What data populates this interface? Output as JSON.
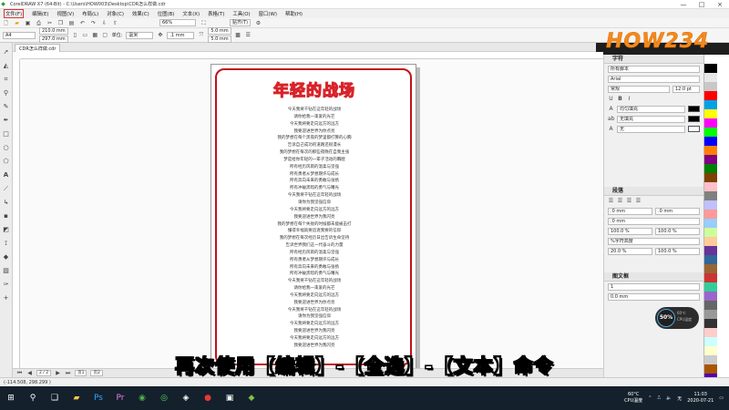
{
  "window": {
    "title": "CorelDRAW X7 (64-Bit) - C:\\Users\\HOW003\\Desktop\\CDR怎么样做.cdr",
    "controls": [
      "—",
      "□",
      "×"
    ]
  },
  "menu": [
    "文件(F)",
    "编辑(E)",
    "视图(V)",
    "布局(L)",
    "对象(C)",
    "效果(C)",
    "位图(B)",
    "文本(X)",
    "表格(T)",
    "工具(O)",
    "窗口(W)",
    "帮助(H)"
  ],
  "toolbar1": {
    "zoom": "66%",
    "snap": "贴齐(T)",
    "icons": [
      "new-icon",
      "open-icon",
      "save-icon",
      "print-icon",
      "cut-icon",
      "copy-icon",
      "paste-icon",
      "undo-icon",
      "redo-icon",
      "import-icon",
      "export-icon"
    ]
  },
  "toolbar2": {
    "page_size": "A4",
    "width": "210.0 mm",
    "height": "297.0 mm",
    "unit_label": "单位:",
    "unit": "毫米",
    "nudge": ".1 mm",
    "dup_x": "5.0 mm",
    "dup_y": "5.0 mm"
  },
  "document_tab": "CDR怎么样做.cdr",
  "poem": {
    "title": "年轻的战场",
    "lines": [
      "今天我将千钻在这年轻的战场",
      "请你给我一束爱的光芒",
      "今天我将要走向远方的远方",
      "我要迎进世界为你点亮",
      "我的梦想在每个黑夜的梦里都打算的心胸",
      "告诉自己成功的道路还很漫长",
      "我的梦想在每次的那些夜晚在自我主张",
      "梦是给你年轻的一辈子活动的胸膛",
      "所有经历风雨的温柔与坚强",
      "所有勇者从梦想期许与成长",
      "所有奔向未来的勇敢与张扬",
      "所有冲破黑暗的勇气与曙光",
      "今天我将千钻在这年轻的战场",
      "请你为我坚强信仰",
      "今天我将要走向远方的远方",
      "我要迎进世界为我闪亮",
      "我的梦想在每个失败的时候都未能被击打",
      "懂得幸福就要追逐我要的信仰",
      "我的梦想在每次经历日出告诉生命坚持",
      "告诉世界我们这一代奋斗的力量",
      "所有经历风雨的温柔与坚强",
      "所有勇者从梦想期许与成长",
      "所有奔向未来的勇敢与张扬",
      "所有冲破黑暗的勇气与曙光",
      "今天我将千钻在这年轻的战场",
      "请你给我一束爱的光芒",
      "今天我将要走向远方的远方",
      "我要迎进世界为你点亮",
      "今天我将千钻在这年轻的战场",
      "请你为我坚强信仰",
      "今天我将要走向远方的远方",
      "我要迎进世界为我闪亮",
      "今天我将要走向远方的远方",
      "我要迎进世界为我闪亮"
    ]
  },
  "logo": "HOW234",
  "right_panel": {
    "char_title": "字符",
    "script": "所有脚本",
    "font": "Arial",
    "style": "常规",
    "size": "12.0 pt",
    "fill_label": "均匀填充",
    "bg_label": "无填充",
    "outline_label": "无",
    "para_title": "段落",
    "indent1": ".0 mm",
    "indent2": ".0 mm",
    "indent3": ".0 mm",
    "spacing1": "100.0 %",
    "spacing2": "100.0 %",
    "spacing3": "20.0 %",
    "spacing4": "100.0 %",
    "line_spacing": "%字符高度",
    "frame_title": "图文框",
    "frame_val": "0.0 mm",
    "frame_val2": "1"
  },
  "swatch_colors": [
    "#ffffff",
    "#000000",
    "#e8e8e8",
    "#c8c8c8",
    "#ff0000",
    "#00a0e9",
    "#ffff00",
    "#ff00ff",
    "#00ff00",
    "#0000ff",
    "#ff8000",
    "#800080",
    "#008000",
    "#804000",
    "#ffc0cb",
    "#808080",
    "#c0c0ff",
    "#ff9999",
    "#99ccff",
    "#ccff99",
    "#ffcc99",
    "#663399",
    "#336699",
    "#996633",
    "#cc3333",
    "#33cc99",
    "#9966cc",
    "#666666",
    "#999999",
    "#333333",
    "#ffcccc",
    "#ccffff",
    "#ffffcc",
    "#cccccc",
    "#aa5500",
    "#5500aa"
  ],
  "vertical_tabs": [
    "对象管理器",
    "文本属性",
    "其他"
  ],
  "badge": {
    "percent": "50%",
    "line1": "60℃",
    "line2": "CPU温度"
  },
  "pagenav": {
    "current": "2 / 2",
    "page1": "页1",
    "page2": "页2"
  },
  "status": "(-114.508, 298.299 )",
  "caption": "再次使用【编辑】-【全选】-【文本】命令",
  "taskbar": {
    "temp": "60°C",
    "temp_label": "CPU温度",
    "time": "11:03",
    "date": "2020-07-21",
    "lang": "无"
  }
}
